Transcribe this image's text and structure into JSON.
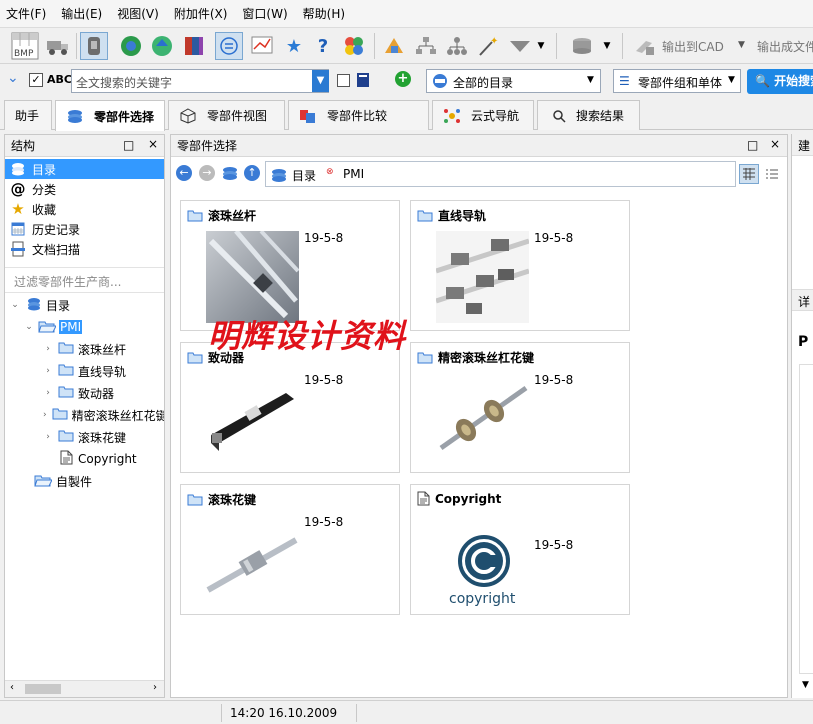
{
  "menu": [
    "文件(F)",
    "输出(E)",
    "视图(V)",
    "附加件(X)",
    "窗口(W)",
    "帮助(H)"
  ],
  "toolbar": {
    "export_cad": "输出到CAD",
    "export_file": "输出成文件",
    "bmp_label": "BMP"
  },
  "search": {
    "placeholder": "全文搜索的关键字",
    "abc_label": "ABC",
    "catalog_scope": "全部的目录",
    "part_mode": "零部件组和单体",
    "start_button": "开始搜索"
  },
  "tabs": [
    "助手",
    "零部件选择",
    "零部件视图",
    "零部件比较",
    "云式导航",
    "搜索结果"
  ],
  "left": {
    "title": "结构",
    "nav": [
      "目录",
      "分类",
      "收藏",
      "历史记录",
      "文档扫描"
    ],
    "filter_placeholder": "过滤零部件生产商...",
    "tree": [
      "目录",
      "PMI",
      "滚珠丝杆",
      "直线导轨",
      "致动器",
      "精密滚珠丝杠花键",
      "滚珠花键",
      "Copyright",
      "自製件"
    ]
  },
  "center": {
    "title": "零部件选择",
    "breadcrumb": [
      "目录",
      "PMI"
    ],
    "watermark": "明辉设计资料",
    "cards": [
      {
        "title": "滚珠丝杆",
        "date": "19-5-8"
      },
      {
        "title": "直线导轨",
        "date": "19-5-8"
      },
      {
        "title": "致动器",
        "date": "19-5-8"
      },
      {
        "title": "精密滚珠丝杠花键",
        "date": "19-5-8"
      },
      {
        "title": "滚珠花键",
        "date": "19-5-8"
      },
      {
        "title": "Copyright",
        "date": "19-5-8",
        "logo_text": "copyright"
      }
    ]
  },
  "right": {
    "title1": "建",
    "title2": "详",
    "letter": "P"
  },
  "status": {
    "time": "14:20 16.10.2009"
  }
}
